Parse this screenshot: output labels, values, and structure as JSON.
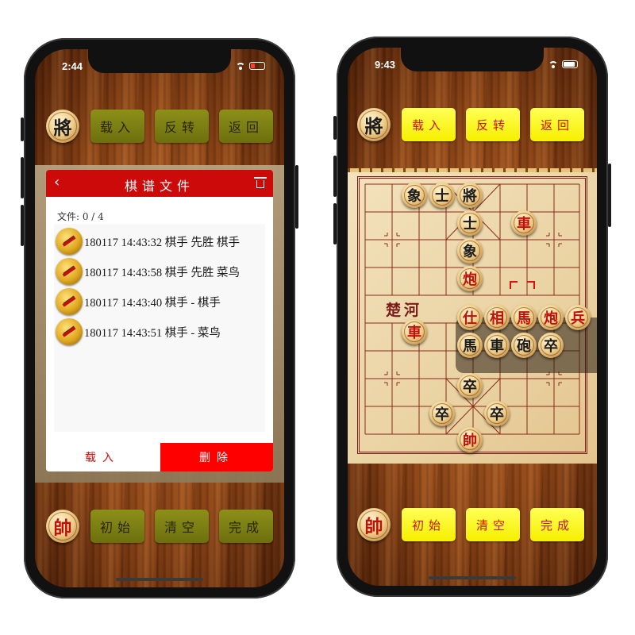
{
  "left_phone": {
    "status": {
      "time": "2:44",
      "battery_color": "#ff3b30"
    },
    "top_bar": {
      "general_piece": "將",
      "buttons": [
        "载入",
        "反转",
        "返回"
      ]
    },
    "dialog": {
      "title": "棋谱文件",
      "back_icon": "chevron-left-icon",
      "trash_icon": "trash-icon",
      "count_text": "文件: 0 / 4",
      "files": [
        "180117 14:43:32 棋手 先胜 棋手",
        "180117 14:43:58 棋手 先胜 菜鸟",
        "180117 14:43:40 棋手 - 棋手",
        "180117 14:43:51 棋手 - 菜鸟"
      ],
      "load_label": "载入",
      "delete_label": "删除"
    },
    "bottom_bar": {
      "marshal_piece": "帥",
      "buttons": [
        "初始",
        "清空",
        "完成"
      ]
    }
  },
  "right_phone": {
    "status": {
      "time": "9:43",
      "battery_color": "#ffffff"
    },
    "top_bar": {
      "general_piece": "將",
      "buttons": [
        "载入",
        "反转",
        "返回"
      ]
    },
    "board": {
      "river_text": "楚河",
      "pieces": [
        {
          "char": "象",
          "side": "black"
        },
        {
          "char": "士",
          "side": "black"
        },
        {
          "char": "將",
          "side": "black"
        },
        {
          "char": "士",
          "side": "black"
        },
        {
          "char": "車",
          "side": "red"
        },
        {
          "char": "象",
          "side": "black"
        },
        {
          "char": "炮",
          "side": "red"
        },
        {
          "char": "車",
          "side": "red"
        },
        {
          "char": "卒",
          "side": "black"
        },
        {
          "char": "卒",
          "side": "black"
        },
        {
          "char": "卒",
          "side": "black"
        },
        {
          "char": "帥",
          "side": "red"
        }
      ],
      "tray_red": [
        "仕",
        "相",
        "馬",
        "炮",
        "兵"
      ],
      "tray_black": [
        "馬",
        "車",
        "砲",
        "卒"
      ]
    },
    "bottom_bar": {
      "marshal_piece": "帥",
      "buttons": [
        "初始",
        "清空",
        "完成"
      ]
    }
  },
  "colors": {
    "dialog_red": "#cc0a0a",
    "delete_red": "#ff0000",
    "olive_button": "#7d800f",
    "yellow_button": "#ffff22",
    "red_piece_text": "#c0100a",
    "board_line": "#7a1b1b"
  }
}
